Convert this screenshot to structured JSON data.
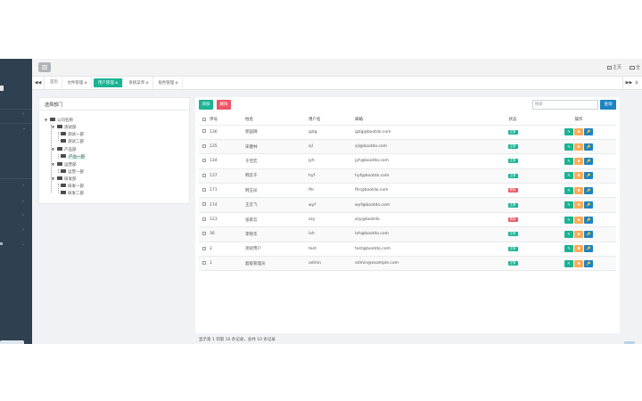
{
  "topbar": {
    "home_label": "主页",
    "fullscreen_label": "全"
  },
  "tabs": {
    "prev": "◀◀",
    "next": "▶▶",
    "close_all": "关",
    "items": [
      {
        "label": "首页",
        "active": false
      },
      {
        "label": "文件管理",
        "active": false
      },
      {
        "label": "用户管理",
        "active": true
      },
      {
        "label": "系统菜单",
        "active": false
      },
      {
        "label": "角色管理",
        "active": false
      }
    ]
  },
  "dept": {
    "title": "选择部门",
    "nodes": [
      {
        "label": "公司名称",
        "level": 0,
        "toggle": "▼"
      },
      {
        "label": "测试部",
        "level": 1,
        "toggle": "▼"
      },
      {
        "label": "测试一部",
        "level": 2,
        "toggle": ""
      },
      {
        "label": "测试二部",
        "level": 2,
        "toggle": ""
      },
      {
        "label": "产品部",
        "level": 1,
        "toggle": "▼"
      },
      {
        "label": "产品一部",
        "level": 2,
        "toggle": "",
        "selected": true
      },
      {
        "label": "运营部",
        "level": 1,
        "toggle": "▼"
      },
      {
        "label": "运营一部",
        "level": 2,
        "toggle": ""
      },
      {
        "label": "研发部",
        "level": 1,
        "toggle": "▼"
      },
      {
        "label": "研发一部",
        "level": 2,
        "toggle": ""
      },
      {
        "label": "研发二部",
        "level": 2,
        "toggle": ""
      }
    ]
  },
  "toolbar": {
    "add_label": "添加",
    "delete_label": "删除",
    "search_placeholder": "搜索",
    "search_label": "查询"
  },
  "table": {
    "headers": {
      "seq": "序号",
      "name": "姓名",
      "account": "用户名",
      "email": "邮箱",
      "status": "状态",
      "ops": "操作"
    },
    "rows": [
      {
        "seq": "136",
        "name": "郭国璐",
        "account": "gzlg",
        "email": "gzlg@bootdo.com",
        "status": "正常",
        "active": true
      },
      {
        "seq": "135",
        "name": "宋健林",
        "account": "sjl",
        "email": "sjl@bootdo.com",
        "status": "正常",
        "active": true
      },
      {
        "seq": "134",
        "name": "于佳宏",
        "account": "jyh",
        "email": "jyh@bootdo.com",
        "status": "正常",
        "active": true
      },
      {
        "seq": "137",
        "name": "韩云于",
        "account": "hyf",
        "email": "hyf@bootdo.com",
        "status": "正常",
        "active": true
      },
      {
        "seq": "171",
        "name": "韩玉凤",
        "account": "fhr",
        "email": "fhr@bootdo.com",
        "status": "禁用",
        "active": false
      },
      {
        "seq": "174",
        "name": "王云飞",
        "account": "wyf",
        "email": "wyf@bootdo.com",
        "status": "正常",
        "active": true
      },
      {
        "seq": "123",
        "name": "张家云",
        "account": "zzy",
        "email": "zzy@bootdo",
        "status": "禁用",
        "active": false
      },
      {
        "seq": "36",
        "name": "李晓华",
        "account": "lxh",
        "email": "lxh@bootdo.com",
        "status": "正常",
        "active": true
      },
      {
        "seq": "2",
        "name": "测试用户",
        "account": "test",
        "email": "test@bootdo.com",
        "status": "正常",
        "active": true
      },
      {
        "seq": "1",
        "name": "超级管理员",
        "account": "admin",
        "email": "admin@example.com",
        "status": "正常",
        "active": true
      }
    ],
    "op_icons": {
      "edit": "✎",
      "reset": "✖",
      "key": "🔑"
    }
  },
  "pager": {
    "info": "显示第 1 到第 10 条记录，总共 10 条记录"
  },
  "colors": {
    "sidebar": "#2f4050",
    "primary": "#1ab394",
    "danger": "#ed5565",
    "warning": "#f8ac59",
    "info": "#1c84c6"
  }
}
